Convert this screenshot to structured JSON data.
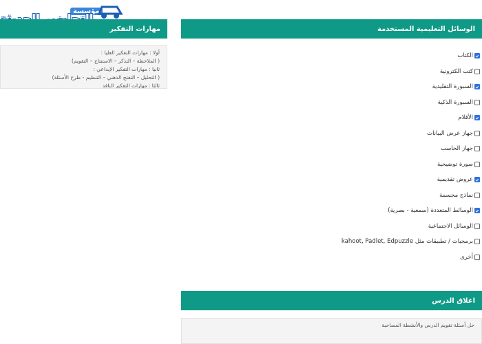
{
  "logo": {
    "top_text": "مؤسسة",
    "main_text": "التحاضير الحديثة"
  },
  "thinking": {
    "header": "مهارات التفكير",
    "lines": [
      "أولا : مهارات التفكير العليا :",
      "( الملاحظة – التذكر – الاستنتاج – التقويم)",
      "ثانيا : مهارات التفكير الإبداعي :",
      "( التحليل – التفتح الذهني – التنظيم - طرح الأسئلة)",
      "ثالثا : مهارات التفكير الناقد"
    ]
  },
  "tools": {
    "header": "الوسائل التعليمية المستخدمة",
    "items": [
      {
        "label": "الكتاب",
        "checked": true
      },
      {
        "label": "كتب الكترونية",
        "checked": false
      },
      {
        "label": "السبورة التقليدية",
        "checked": true
      },
      {
        "label": "السبورة الذكية",
        "checked": false
      },
      {
        "label": "الأقلام",
        "checked": true
      },
      {
        "label": "جهاز عرض البيانات",
        "checked": false
      },
      {
        "label": "جهاز الحاسب",
        "checked": false
      },
      {
        "label": "صورة توضيحية",
        "checked": false
      },
      {
        "label": "عروض تقديمية",
        "checked": true
      },
      {
        "label": "نماذج مجسمة",
        "checked": false
      },
      {
        "label": "الوسائط المتعددة (سمعية - بصرية)",
        "checked": true
      },
      {
        "label": "الوسائل الاجتماعية",
        "checked": false
      },
      {
        "label": "برمجيات / تطبيقات مثل kahoot, Padlet, Edpuzzle",
        "checked": false
      },
      {
        "label": "أخرى",
        "checked": false
      }
    ]
  },
  "closing": {
    "header": "اغلاق الدرس",
    "text": "حل أسئلة تقويم الدرس والأنشطة المصاحبة"
  },
  "colors": {
    "accent": "#0e9a86",
    "checkbox": "#2f6fe0",
    "logo_blue": "#1b5fb5"
  }
}
